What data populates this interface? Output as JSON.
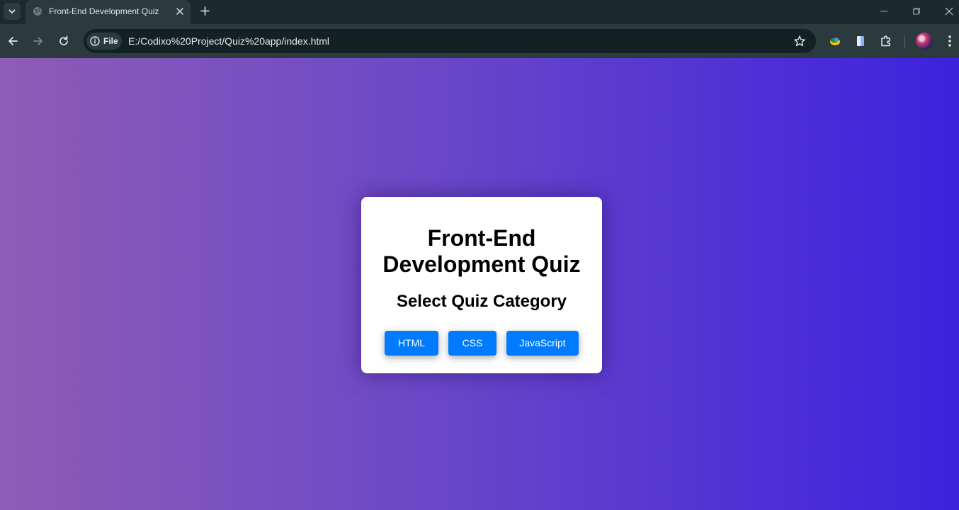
{
  "browser": {
    "tab": {
      "title": "Front-End Development Quiz"
    },
    "omnibox": {
      "chip_label": "File",
      "url": "E:/Codixo%20Project/Quiz%20app/index.html"
    }
  },
  "page": {
    "background": {
      "gradient_start": "#8e5cb6",
      "gradient_end": "#3d22de"
    },
    "card": {
      "title_line1": "Front-End",
      "title_line2": "Development Quiz",
      "subtitle": "Select Quiz Category",
      "buttons": [
        {
          "label": "HTML"
        },
        {
          "label": "CSS"
        },
        {
          "label": "JavaScript"
        }
      ],
      "button_color": "#007bff"
    }
  },
  "icons": {
    "tab_strip": [
      "tab-search-icon",
      "globe-icon",
      "close-icon",
      "plus-icon",
      "minimize-icon",
      "restore-icon",
      "window-close-icon"
    ],
    "toolbar": [
      "back-icon",
      "forward-icon",
      "reload-icon",
      "info-icon",
      "star-icon",
      "extension-app-icon",
      "document-icon",
      "puzzle-icon",
      "profile-avatar",
      "menu-dots-icon"
    ]
  }
}
